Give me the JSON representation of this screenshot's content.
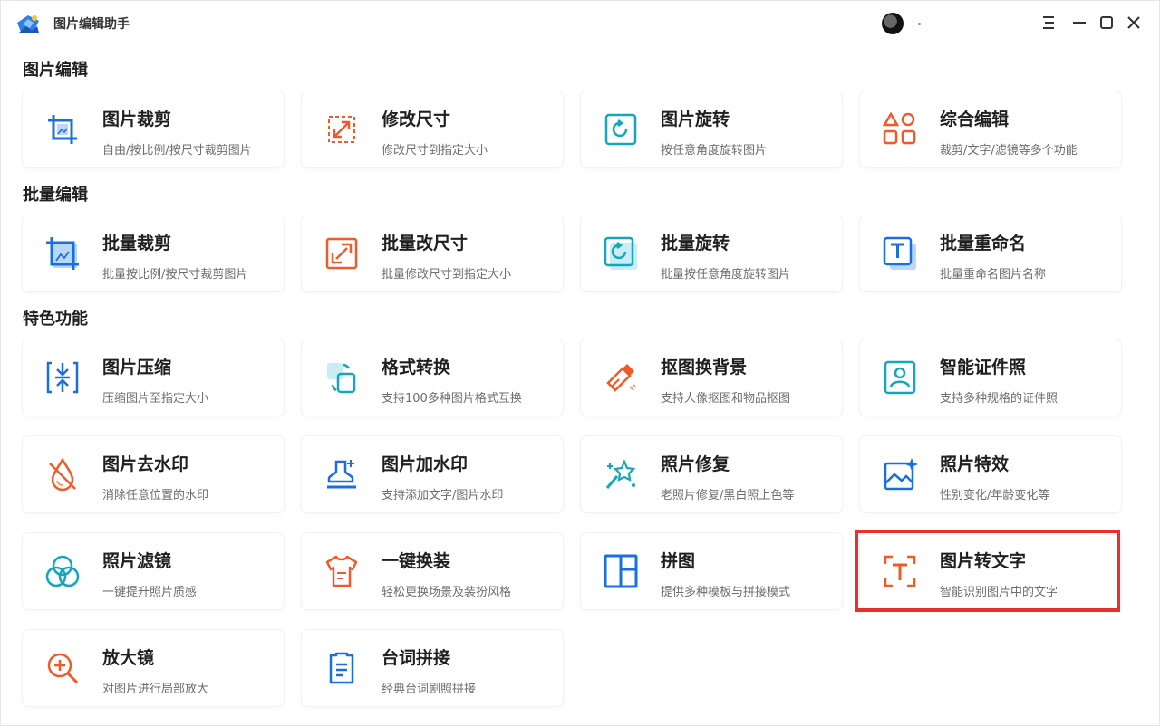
{
  "app": {
    "title": "图片编辑助手",
    "avatar_label": "·"
  },
  "window_controls": {
    "menu_icon": "menu-icon",
    "minimize_icon": "minimize-icon",
    "maximize_icon": "maximize-icon",
    "close_icon": "close-icon"
  },
  "colors": {
    "blue": "#1a6fe0",
    "orange": "#f05a28",
    "teal": "#14a6bd",
    "highlight": "#e8302f"
  },
  "sections": [
    {
      "title": "图片编辑",
      "cards": [
        {
          "title": "图片裁剪",
          "desc": "自由/按比例/按尺寸裁剪图片",
          "icon": "crop-icon"
        },
        {
          "title": "修改尺寸",
          "desc": "修改尺寸到指定大小",
          "icon": "resize-icon"
        },
        {
          "title": "图片旋转",
          "desc": "按任意角度旋转图片",
          "icon": "rotate-icon"
        },
        {
          "title": "综合编辑",
          "desc": "裁剪/文字/滤镜等多个功能",
          "icon": "shapes-icon"
        }
      ]
    },
    {
      "title": "批量编辑",
      "cards": [
        {
          "title": "批量裁剪",
          "desc": "批量按比例/按尺寸裁剪图片",
          "icon": "batch-crop-icon"
        },
        {
          "title": "批量改尺寸",
          "desc": "批量修改尺寸到指定大小",
          "icon": "batch-resize-icon"
        },
        {
          "title": "批量旋转",
          "desc": "批量按任意角度旋转图片",
          "icon": "batch-rotate-icon"
        },
        {
          "title": "批量重命名",
          "desc": "批量重命名图片名称",
          "icon": "batch-rename-icon"
        }
      ]
    },
    {
      "title": "特色功能",
      "cards": [
        {
          "title": "图片压缩",
          "desc": "压缩图片至指定大小",
          "icon": "compress-icon"
        },
        {
          "title": "格式转换",
          "desc": "支持100多种图片格式互换",
          "icon": "convert-icon"
        },
        {
          "title": "抠图换背景",
          "desc": "支持人像抠图和物品抠图",
          "icon": "eraser-icon"
        },
        {
          "title": "智能证件照",
          "desc": "支持多种规格的证件照",
          "icon": "id-photo-icon"
        },
        {
          "title": "图片去水印",
          "desc": "消除任意位置的水印",
          "icon": "remove-watermark-icon"
        },
        {
          "title": "图片加水印",
          "desc": "支持添加文字/图片水印",
          "icon": "stamp-icon"
        },
        {
          "title": "照片修复",
          "desc": "老照片修复/黑白照上色等",
          "icon": "magic-wand-icon"
        },
        {
          "title": "照片特效",
          "desc": "性别变化/年龄变化等",
          "icon": "effects-icon"
        },
        {
          "title": "照片滤镜",
          "desc": "一键提升照片质感",
          "icon": "filter-icon"
        },
        {
          "title": "一键换装",
          "desc": "轻松更换场景及装扮风格",
          "icon": "shirt-icon"
        },
        {
          "title": "拼图",
          "desc": "提供多种模板与拼接模式",
          "icon": "collage-icon"
        },
        {
          "title": "图片转文字",
          "desc": "智能识别图片中的文字",
          "icon": "ocr-icon"
        },
        {
          "title": "放大镜",
          "desc": "对图片进行局部放大",
          "icon": "magnifier-icon"
        },
        {
          "title": "台词拼接",
          "desc": "经典台词剧照拼接",
          "icon": "script-icon"
        }
      ]
    }
  ]
}
